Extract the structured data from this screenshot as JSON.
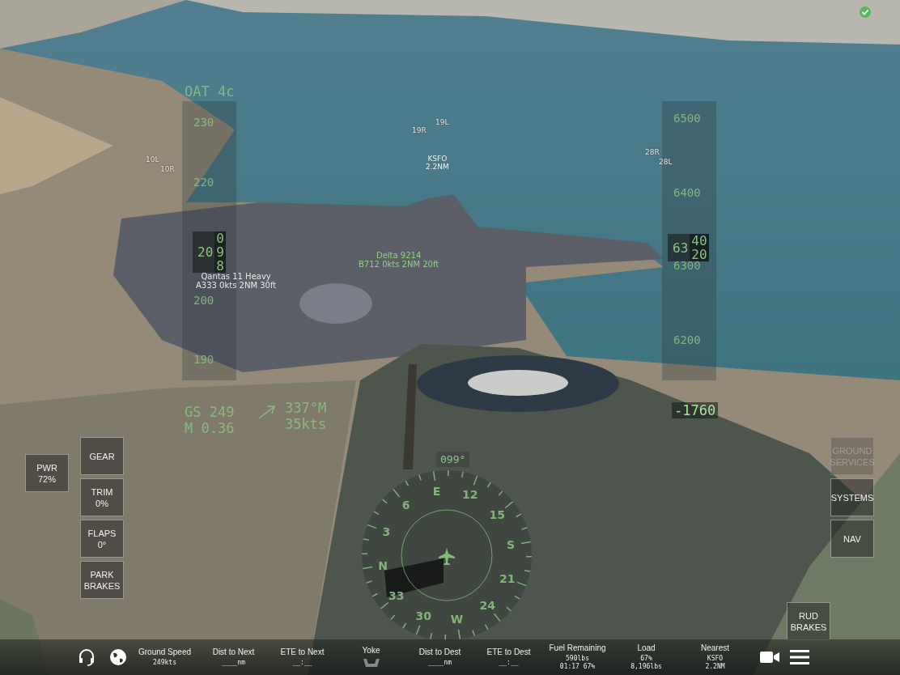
{
  "hud": {
    "oat": "OAT 4c",
    "speed_tape": {
      "ticks": [
        "230",
        "220",
        "200",
        "190"
      ],
      "readout": {
        "lead": "20",
        "digits": [
          "0",
          "9",
          "8"
        ]
      }
    },
    "ground_speed": "GS 249",
    "mach": "M 0.36",
    "wind": {
      "direction": "337°M",
      "speed": "35kts"
    },
    "altitude_tape": {
      "ticks": [
        "6500",
        "6400",
        "6300",
        "6200"
      ],
      "readout": {
        "lead": "63",
        "digits": [
          "40",
          "20"
        ]
      }
    },
    "vertical_speed": "-1760",
    "heading": "099°",
    "compass_labels": [
      "N",
      "3",
      "6",
      "E",
      "12",
      "15",
      "S",
      "21",
      "24",
      "W",
      "30",
      "33"
    ]
  },
  "runway_labels": [
    "19L",
    "19R",
    "10L",
    "10R",
    "28R",
    "28L"
  ],
  "airport_label": {
    "code": "KSFO",
    "distance": "2.2NM"
  },
  "traffic": [
    {
      "callsign": "Delta 9214",
      "info": "B712 0kts 2NM 20ft",
      "color": "#8fd07f"
    },
    {
      "callsign": "Qantas 11 Heavy",
      "info": "A333 0kts 2NM 30ft",
      "color": "#e6e6e6"
    }
  ],
  "power": {
    "label": "PWR",
    "value": "72%"
  },
  "left_buttons": [
    {
      "label": "GEAR"
    },
    {
      "label": "TRIM",
      "value": "0%"
    },
    {
      "label": "FLAPS",
      "value": "0°"
    },
    {
      "label": "PARK BRAKES"
    }
  ],
  "right_buttons": [
    {
      "label": "GROUND SERVICES",
      "disabled": true
    },
    {
      "label": "SYSTEMS",
      "disabled": false
    },
    {
      "label": "NAV",
      "disabled": false
    }
  ],
  "rudder_button": {
    "label": "RUD BRAKES"
  },
  "bottom_bar": [
    {
      "kind": "text",
      "label": "Ground Speed",
      "value": "249kts"
    },
    {
      "kind": "text",
      "label": "Dist to Next",
      "value": "____nm"
    },
    {
      "kind": "text",
      "label": "ETE to Next",
      "value": "__:__"
    },
    {
      "kind": "icon",
      "label": "Yoke"
    },
    {
      "kind": "text",
      "label": "Dist to Dest",
      "value": "____nm"
    },
    {
      "kind": "text",
      "label": "ETE to Dest",
      "value": "__:__"
    },
    {
      "kind": "text",
      "label": "Fuel Remaining",
      "value": "590lbs",
      "detail": "01:17 67%"
    },
    {
      "kind": "text",
      "label": "Load",
      "value": "67%",
      "detail": "8,196lbs"
    },
    {
      "kind": "text",
      "label": "Nearest",
      "value": "KSFO",
      "detail": "2.2NM"
    }
  ]
}
